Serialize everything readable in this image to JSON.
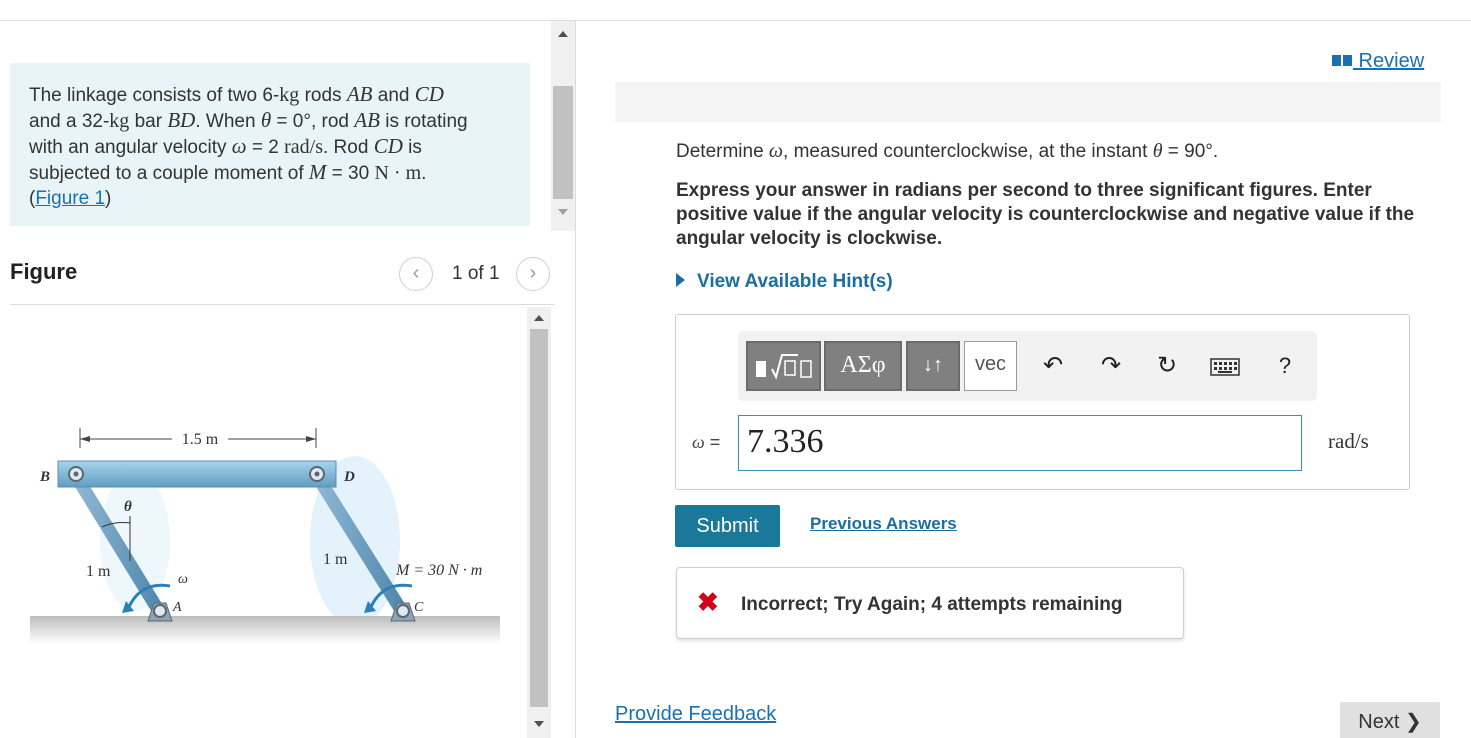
{
  "problem": {
    "text_1": "The linkage consists of two 6-",
    "kg": "kg",
    "text_2": " rods ",
    "rod_ab": "AB",
    "text_3": " and ",
    "rod_cd": "CD",
    "text_4": "and a 32-",
    "text_5": " bar ",
    "bar_bd": "BD",
    "text_6": ". When ",
    "theta": "θ",
    "eq_zero": " = 0°",
    "text_7": ", rod ",
    "text_8": " is rotating",
    "text_9": "with an angular velocity ",
    "omega": "ω",
    "eq_two": " = 2 ",
    "rads": "rad/s",
    "text_10": ". Rod ",
    "text_11": " is",
    "text_12": "subjected to a couple moment of ",
    "moment_sym": "M",
    "eq_thirty": " = 30 ",
    "nm": "N · m",
    "period": ".",
    "figure_link": "Figure 1",
    "open_paren": "(",
    "close_paren": ")"
  },
  "figure_panel": {
    "title": "Figure",
    "pager_text": "1 of 1",
    "prev_icon": "chevron-left-icon",
    "next_icon": "chevron-right-icon",
    "labels": {
      "span": "1.5 m",
      "b": "B",
      "d": "D",
      "theta": "θ",
      "rod_left": "1 m",
      "rod_right": "1 m",
      "omega": "ω",
      "moment": "M = 30 N · m",
      "a": "A",
      "c": "C"
    }
  },
  "review": {
    "icon": "book-icon",
    "label": " Review"
  },
  "question": {
    "prefix": "Determine ",
    "omega": "ω",
    "middle": ", measured counterclockwise, at the instant ",
    "theta": "θ",
    "suffix": " = 90°."
  },
  "instructions": "Express your answer in radians per second to three significant figures. Enter positive value if the angular velocity is counterclockwise and negative value if the angular velocity is clockwise.",
  "hints_label": "View Available Hint(s)",
  "toolbar": {
    "templates_icon": "templates-icon",
    "greek_label": "ΑΣφ",
    "arrows_label": "↓↑",
    "vec_label": "vec",
    "undo_icon": "undo-icon",
    "redo_icon": "redo-icon",
    "reset_icon": "reset-icon",
    "keyboard_icon": "keyboard-icon",
    "help_label": "?"
  },
  "answer": {
    "variable": "ω",
    "equals": " =",
    "value": "7.336",
    "unit": "rad/s"
  },
  "submit_label": "Submit",
  "previous_answers_label": "Previous Answers",
  "feedback": {
    "icon": "✖",
    "message": "Incorrect; Try Again; 4 attempts remaining",
    "status_color": "#d0021b"
  },
  "provide_feedback_label": "Provide Feedback",
  "next_label": "Next ❯",
  "colors": {
    "accent": "#1a7898",
    "link": "#1a70b0",
    "problem_bg": "#e8f4f7"
  }
}
